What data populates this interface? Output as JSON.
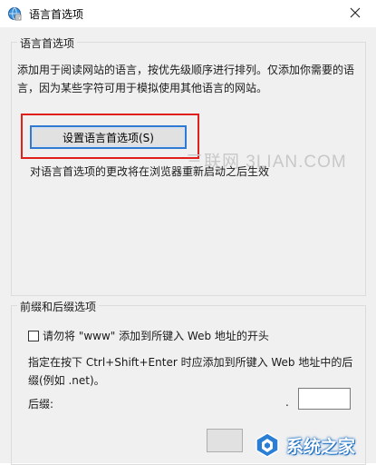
{
  "window": {
    "title": "语言首选项",
    "icon": "internet-options-icon"
  },
  "language_group": {
    "legend": "语言首选项",
    "description": "添加用于阅读网站的语言，按优先级顺序进行排列。仅添加你需要的语言，因为某些字符可用于模拟使用其他语言的网站。",
    "settings_button_label": "设置语言首选项(S)",
    "note": "对语言首选项的更改将在浏览器重新启动之后生效",
    "highlight_color": "#e0201c"
  },
  "prefix_group": {
    "legend": "前缀和后缀选项",
    "checkbox_label": "请勿将 \"www\" 添加到所键入 Web 地址的开头",
    "checkbox_checked": false,
    "description": "指定在按下 Ctrl+Shift+Enter 时应添加到所键入 Web 地址中的后缀(例如 .net)。",
    "suffix_label": "后缀:",
    "suffix_prefix_dot": ".",
    "suffix_value": ""
  },
  "watermarks": {
    "center": "三联网 3LIAN.COM",
    "corner": "系统之家"
  }
}
